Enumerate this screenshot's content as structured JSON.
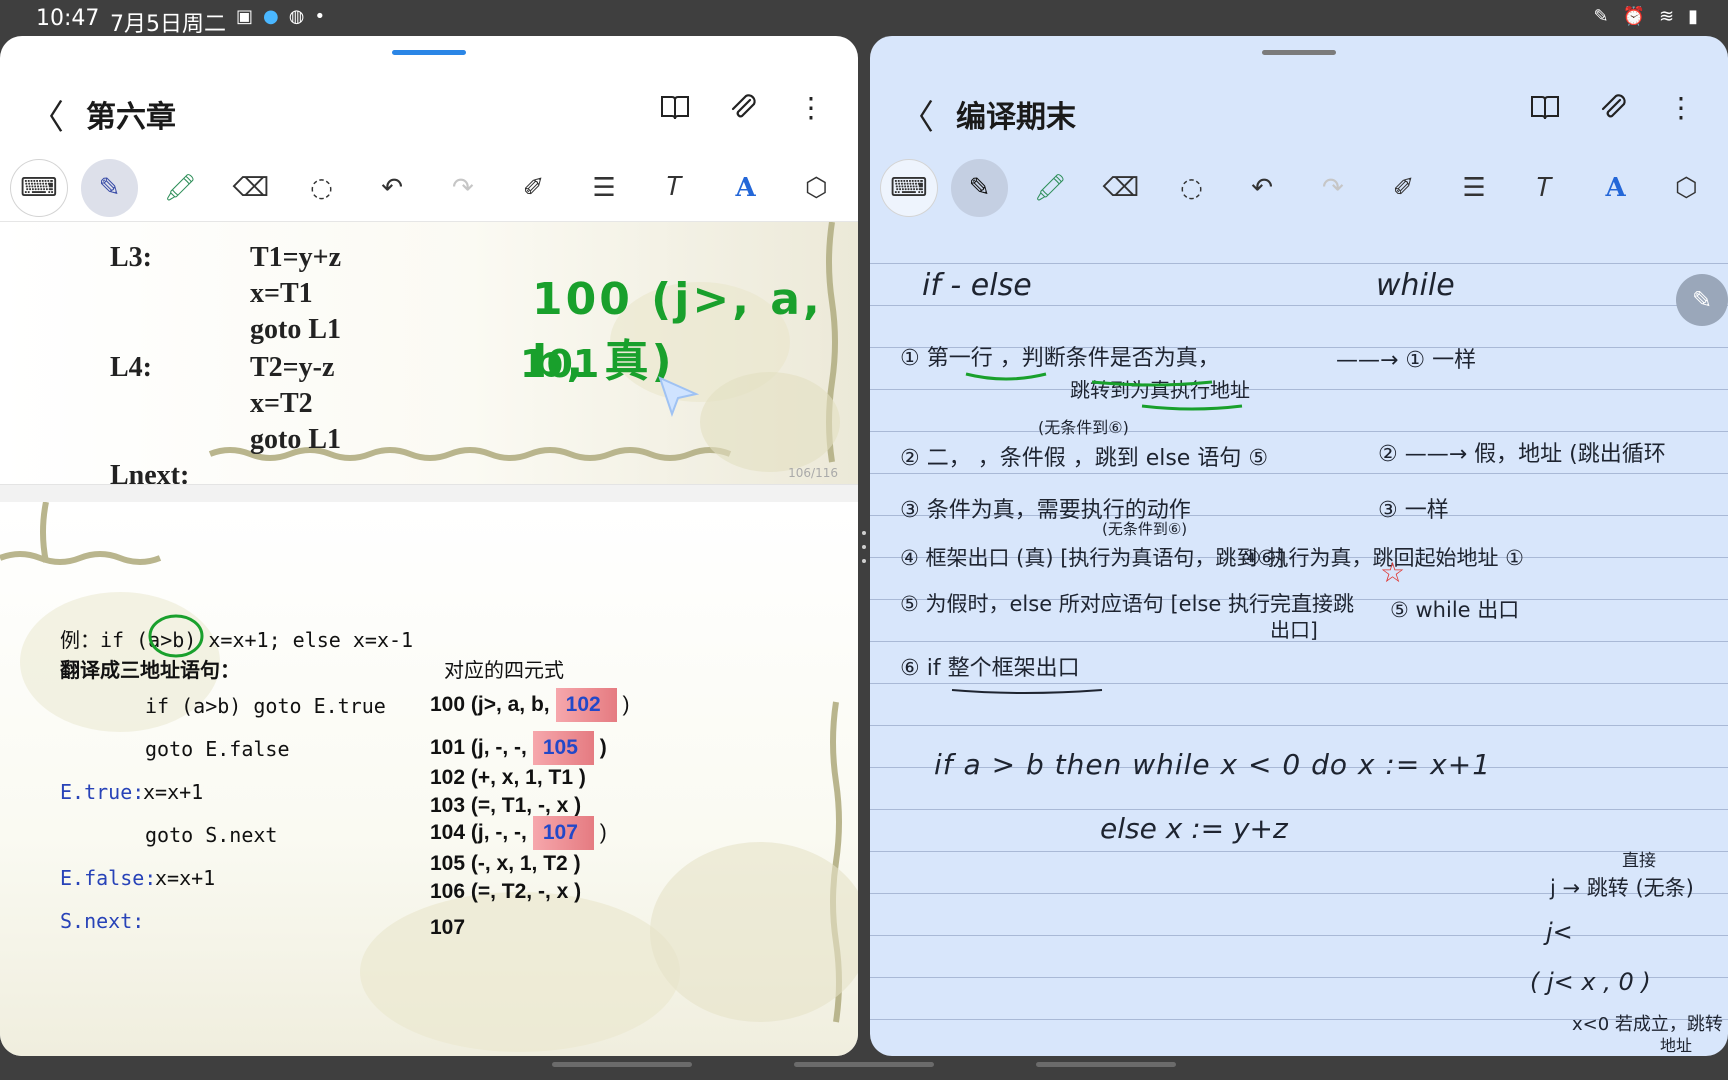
{
  "status": {
    "time": "10:47",
    "date": "7月5日周二",
    "left_icons": [
      "image-icon",
      "qq-icon",
      "wechat-icon",
      "dot-icon"
    ],
    "right_icons": [
      "pen-icon",
      "alarm-icon",
      "wifi-icon",
      "battery-icon"
    ]
  },
  "left": {
    "title": "第六章",
    "page1": {
      "l3": "L3:",
      "l3_1": "T1=y+z",
      "l3_2": "x=T1",
      "l3_3": "goto L1",
      "l4": "L4:",
      "l4_1": "T2=y-z",
      "l4_2": "x=T2",
      "l4_3": "goto L1",
      "lnext": "Lnext:",
      "page_num": "106/116",
      "ink1": "100 (j>, a, b, 真)",
      "ink2": "101"
    },
    "page2": {
      "example": "例：if (a>b) x=x+1; else  x=x-1",
      "translate": "翻译成三地址语句：",
      "quad_header": "对应的四元式",
      "code": [
        {
          "label": "",
          "text": "if (a>b) goto E.true"
        },
        {
          "label": "",
          "text": "goto E.false"
        },
        {
          "label": "E.true:",
          "text": "x=x+1"
        },
        {
          "label": "",
          "text": "goto S.next"
        },
        {
          "label": "E.false:",
          "text": "x=x+1"
        },
        {
          "label": "S.next:",
          "text": ""
        }
      ],
      "quads": {
        "q100_pre": "100 (j>, a, b,",
        "q100_val": "102",
        "q100_post": ")",
        "q101_pre": "101 (j, -, -,",
        "q101_val": "105",
        "q101_post": ")",
        "q102": "102 (+, x, 1, T1 )",
        "q103": "103 (=, T1, -, x )",
        "q104_pre": "104 (j, -, -,",
        "q104_val": "107",
        "q104_post": ")",
        "q105": "105 (-, x, 1, T2 )",
        "q106": "106 (=, T2, -, x )",
        "q107": "107"
      }
    }
  },
  "right": {
    "title": "编译期末",
    "notes": {
      "h_ifelse": "if - else",
      "h_while": "while",
      "n1": "① 第一行 ，判断条件是否为真，",
      "n1b": "跳转到为真执行地址",
      "n1r": "——→ ① 一样",
      "n2": "② 二，  ，条件假 ，跳到 else 语句 ⑤",
      "n2top": "(无条件到⑥)",
      "n2r": "② ——→ 假，地址 (跳出循环",
      "n3": "③ 条件为真，需要执行的动作",
      "n3r": "③ 一样",
      "n4": "④ 框架出口 (真)  [执行为真语句，跳到⑥]",
      "n4top": "(无条件到⑥)",
      "n4r": "④ 执行为真，跳回起始地址 ①",
      "n5": "⑤ 为假时，else 所对应语句 [else 执行完直接跳",
      "n5b": "出口]",
      "n5r": "⑤ while 出口",
      "n6": "⑥ if 整个框架出口",
      "code1": "if  a > b  then   while  x < 0  do  x := x+1",
      "code2": "else    x := y+z",
      "side1top": "直接",
      "side1": "j → 跳转 (无条)",
      "side2": "j<",
      "side3": "( j<   x ,  0 )",
      "side4": "x<0 若成立，跳转",
      "side4b": "地址"
    }
  }
}
